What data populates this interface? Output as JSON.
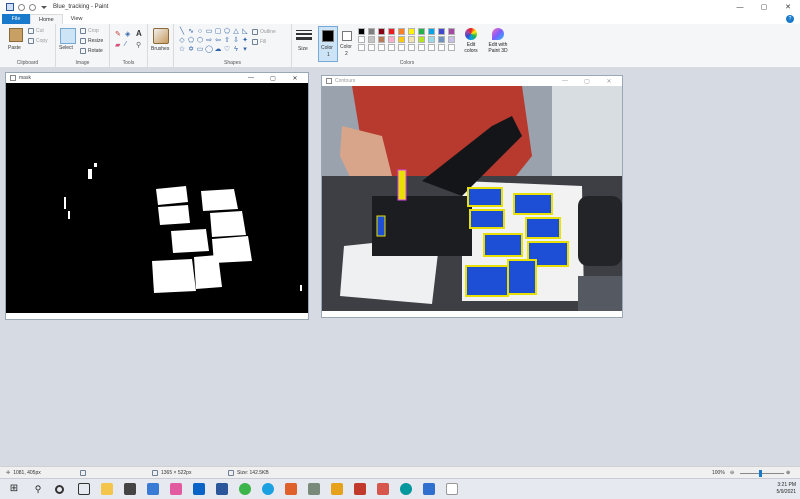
{
  "app": {
    "title": "Blue_tracking - Paint",
    "window_controls": [
      "—",
      "▢",
      "✕"
    ]
  },
  "menu": {
    "tabs": [
      "File",
      "Home",
      "View"
    ],
    "active": "Home"
  },
  "ribbon": {
    "clipboard": {
      "paste": "Paste",
      "cut": "Cut",
      "copy": "Copy",
      "caption": "Clipboard"
    },
    "image": {
      "select": "Select",
      "crop": "Crop",
      "resize": "Resize",
      "rotate": "Rotate",
      "caption": "Image"
    },
    "tools": {
      "caption": "Tools",
      "text_tool": "A"
    },
    "brushes": {
      "label": "Brushes"
    },
    "shapes": {
      "outline": "Outline",
      "fill": "Fill",
      "caption": "Shapes"
    },
    "size": {
      "label": "Size"
    },
    "color1": {
      "label": "Color",
      "num": "1"
    },
    "color2": {
      "label": "Color",
      "num": "2"
    },
    "colors": {
      "caption": "Colors",
      "edit": "Edit colors",
      "edit_paint3d": "Edit with Paint 3D"
    }
  },
  "palette": [
    "#000000",
    "#7f7f7f",
    "#880015",
    "#ed1c24",
    "#ff7f27",
    "#fff200",
    "#22b14c",
    "#00a2e8",
    "#3f48cc",
    "#a349a4",
    "#ffffff",
    "#c3c3c3",
    "#b97a57",
    "#ffaec9",
    "#ffc90e",
    "#efe4b0",
    "#b5e61d",
    "#99d9ea",
    "#7092be",
    "#c8bfe7",
    "#ffffff",
    "#ffffff",
    "#ffffff",
    "#ffffff",
    "#ffffff",
    "#ffffff",
    "#ffffff",
    "#ffffff",
    "#ffffff",
    "#ffffff"
  ],
  "windows": {
    "mask": {
      "title": "mask"
    },
    "contours": {
      "title": "Contours"
    }
  },
  "status": {
    "cursor": "1081, 405px",
    "selection": "1365 × 522px",
    "size": "Size: 142.5KB",
    "zoom": "100%"
  },
  "taskbar": {
    "time": "3:21 PM",
    "date": "5/9/2021"
  }
}
